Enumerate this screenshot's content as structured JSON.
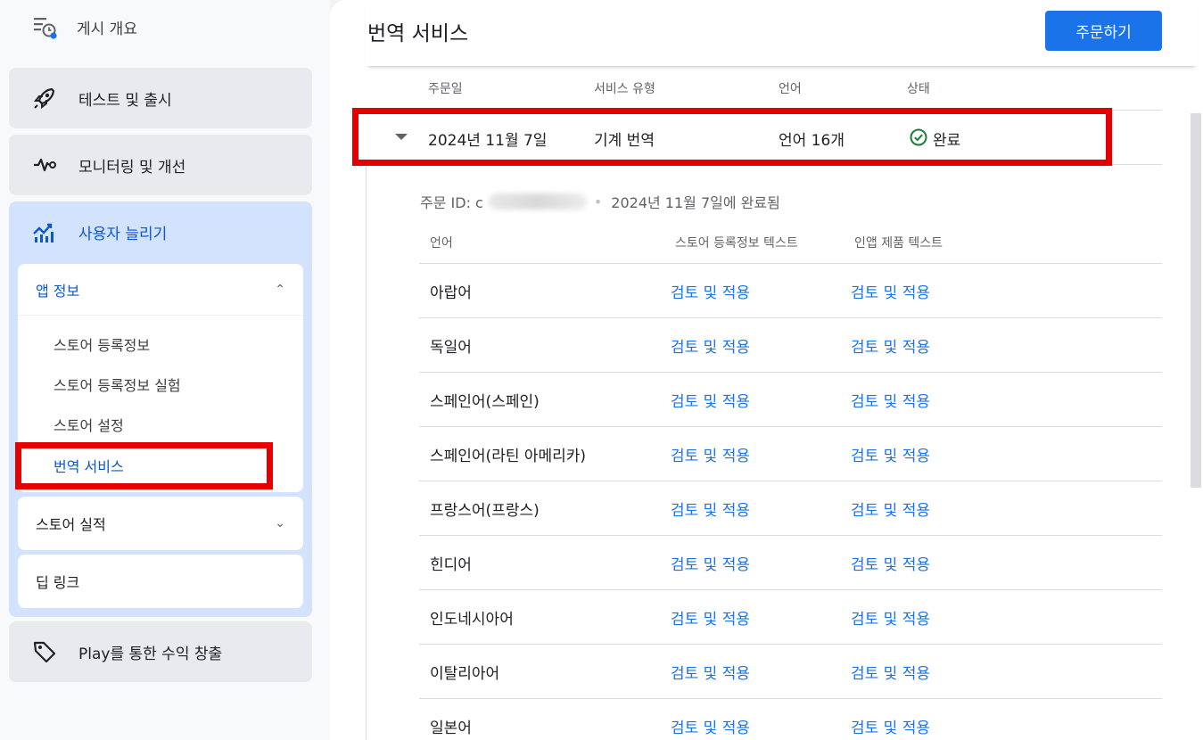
{
  "sidebar": {
    "overview_label": "게시 개요",
    "test_release_label": "테스트 및 출시",
    "monitor_label": "모니터링 및 개선",
    "grow_label": "사용자 늘리기",
    "app_info": {
      "label": "앱 정보",
      "items": [
        "스토어 등록정보",
        "스토어 등록정보 실험",
        "스토어 설정",
        "번역 서비스"
      ]
    },
    "store_performance_label": "스토어 실적",
    "deep_links_label": "딥 링크",
    "monetize_label": "Play를 통한 수익 창출"
  },
  "header": {
    "title": "번역 서비스",
    "order_button": "주문하기"
  },
  "orders_table": {
    "columns": [
      "주문일",
      "서비스 유형",
      "언어",
      "상태"
    ],
    "row": {
      "date": "2024년 11월 7일",
      "service_type": "기계 번역",
      "languages": "언어 16개",
      "status": "완료"
    }
  },
  "order_detail": {
    "order_id_label": "주문 ID: c",
    "completed_text": "2024년 11월 7일에 완료됨",
    "columns": [
      "언어",
      "스토어 등록정보 텍스트",
      "인앱 제품 텍스트"
    ],
    "action_label": "검토 및 적용",
    "languages": [
      "아랍어",
      "독일어",
      "스페인어(스페인)",
      "스페인어(라틴 아메리카)",
      "프랑스어(프랑스)",
      "힌디어",
      "인도네시아어",
      "이탈리아어",
      "일본어"
    ]
  },
  "colors": {
    "accent": "#1a73e8",
    "highlight": "#e50000",
    "success": "#188038"
  }
}
